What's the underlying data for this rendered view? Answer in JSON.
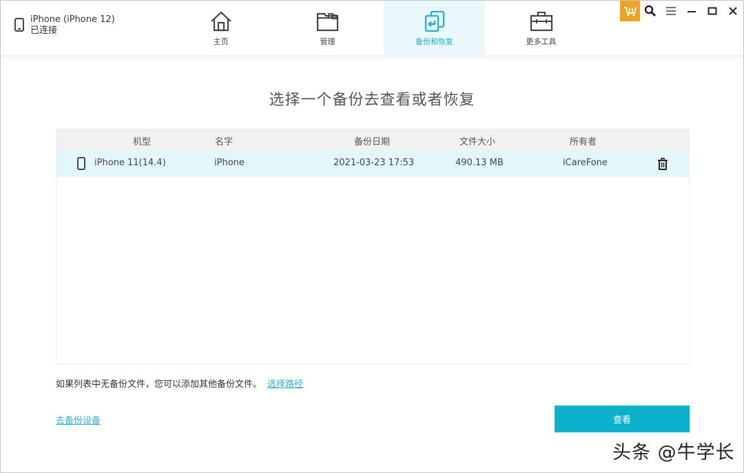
{
  "device": {
    "name": "iPhone (iPhone 12)",
    "status": "已连接"
  },
  "nav": {
    "items": [
      {
        "label": "主页",
        "icon": "home-icon",
        "active": false
      },
      {
        "label": "管理",
        "icon": "folder-icon",
        "active": false
      },
      {
        "label": "备份和恢复",
        "icon": "backup-restore-icon",
        "active": true
      },
      {
        "label": "更多工具",
        "icon": "toolbox-icon",
        "active": false
      }
    ]
  },
  "window_controls": [
    "cart-icon",
    "search-icon",
    "menu-icon",
    "minimize-icon",
    "maximize-icon",
    "close-icon"
  ],
  "colors": {
    "accent": "#0eb1cc",
    "active_tab_bg": "#eaf8fb",
    "selected_row_bg": "#e3f6f9",
    "cart_bg": "#eda32a"
  },
  "main": {
    "title": "选择一个备份去查看或者恢复",
    "table": {
      "headers": [
        "机型",
        "名字",
        "备份日期",
        "文件大小",
        "所有者"
      ],
      "rows": [
        {
          "model": "iPhone 11(14.4)",
          "name": "iPhone",
          "date": "2021-03-23 17:53",
          "size": "490.13 MB",
          "owner": "iCareFone"
        }
      ]
    },
    "hint_text": "如果列表中无备份文件，您可以添加其他备份文件。",
    "choose_path_link": "选择路径",
    "backup_device_link": "去备份设备",
    "view_button": "查看"
  },
  "watermark": "头条 @牛学长"
}
